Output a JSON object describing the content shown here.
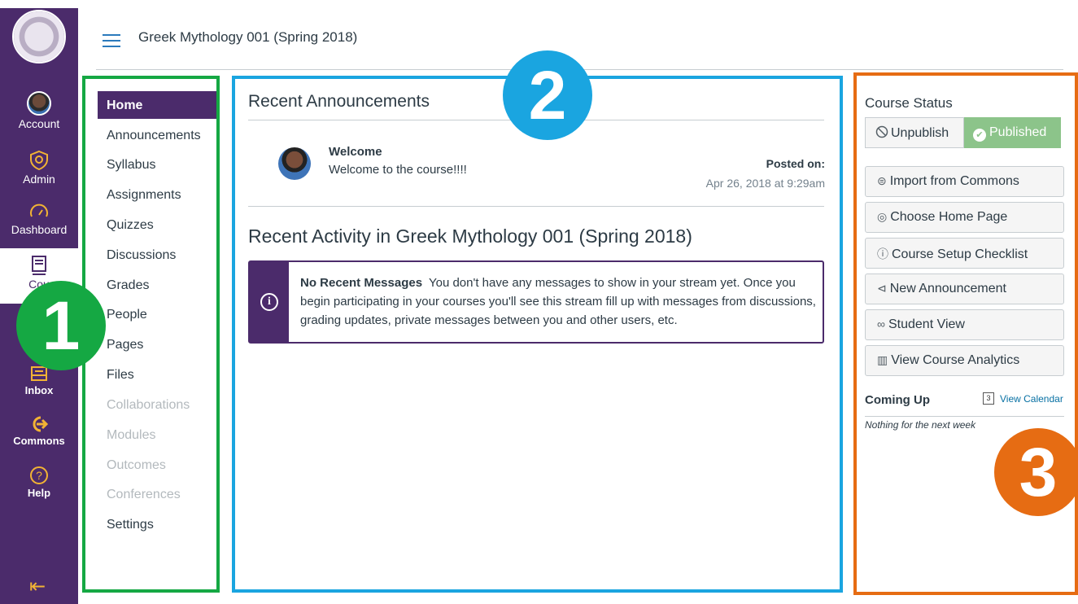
{
  "header": {
    "title": "Greek Mythology 001 (Spring 2018)"
  },
  "global_nav": {
    "items": [
      {
        "label": "Account",
        "icon": "avatar-icon"
      },
      {
        "label": "Admin",
        "icon": "shield-icon"
      },
      {
        "label": "Dashboard",
        "icon": "speedometer-icon"
      },
      {
        "label": "Courses",
        "icon": "book-icon"
      },
      {
        "label": "Inbox",
        "icon": "inbox-icon"
      },
      {
        "label": "Commons",
        "icon": "arrow-right-icon"
      },
      {
        "label": "Help",
        "icon": "question-icon"
      }
    ],
    "courses_visible": "Cou"
  },
  "course_nav": {
    "items": [
      {
        "label": "Home",
        "state": "active"
      },
      {
        "label": "Announcements",
        "state": "enabled"
      },
      {
        "label": "Syllabus",
        "state": "enabled"
      },
      {
        "label": "Assignments",
        "state": "enabled"
      },
      {
        "label": "Quizzes",
        "state": "enabled"
      },
      {
        "label": "Discussions",
        "state": "enabled"
      },
      {
        "label": "Grades",
        "state": "enabled"
      },
      {
        "label": "People",
        "state": "enabled"
      },
      {
        "label": "Pages",
        "state": "enabled"
      },
      {
        "label": "Files",
        "state": "enabled"
      },
      {
        "label": "Collaborations",
        "state": "disabled"
      },
      {
        "label": "Modules",
        "state": "disabled"
      },
      {
        "label": "Outcomes",
        "state": "disabled"
      },
      {
        "label": "Conferences",
        "state": "disabled"
      },
      {
        "label": "Settings",
        "state": "enabled"
      }
    ]
  },
  "main": {
    "recent_announcements_title": "Recent Announcements",
    "announcement": {
      "title": "Welcome",
      "body": "Welcome to the course!!!!",
      "posted_label": "Posted on:",
      "posted_date": "Apr 26, 2018 at 9:29am"
    },
    "recent_activity_title": "Recent Activity in Greek Mythology 001 (Spring 2018)",
    "alert": {
      "heading": "No Recent Messages",
      "text": "You don't have any messages to show in your stream yet. Once you begin participating in your courses you'll see this stream fill up with messages from discussions, grading updates, private messages between you and other users, etc."
    }
  },
  "sidebar": {
    "course_status_label": "Course Status",
    "unpublish_label": "Unpublish",
    "published_label": "Published",
    "buttons": [
      {
        "label": "Import from Commons",
        "icon": "commons-icon"
      },
      {
        "label": "Choose Home Page",
        "icon": "target-icon"
      },
      {
        "label": "Course Setup Checklist",
        "icon": "question-circle-icon"
      },
      {
        "label": "New Announcement",
        "icon": "megaphone-icon"
      },
      {
        "label": "Student View",
        "icon": "glasses-icon"
      },
      {
        "label": "View Course Analytics",
        "icon": "analytics-icon"
      }
    ],
    "coming_up_label": "Coming Up",
    "calendar_day": "3",
    "view_calendar_label": "View Calendar",
    "nothing_label": "Nothing for the next week"
  },
  "callouts": {
    "one": "1",
    "two": "2",
    "three": "3"
  },
  "colors": {
    "nav_purple": "#4b2b6b",
    "nav_icon_gold": "#f2b334",
    "callout_green": "#15a843",
    "callout_blue": "#1aa5e0",
    "callout_orange": "#e66c13",
    "published_green": "#8cc48a",
    "link_blue": "#0770a3"
  }
}
